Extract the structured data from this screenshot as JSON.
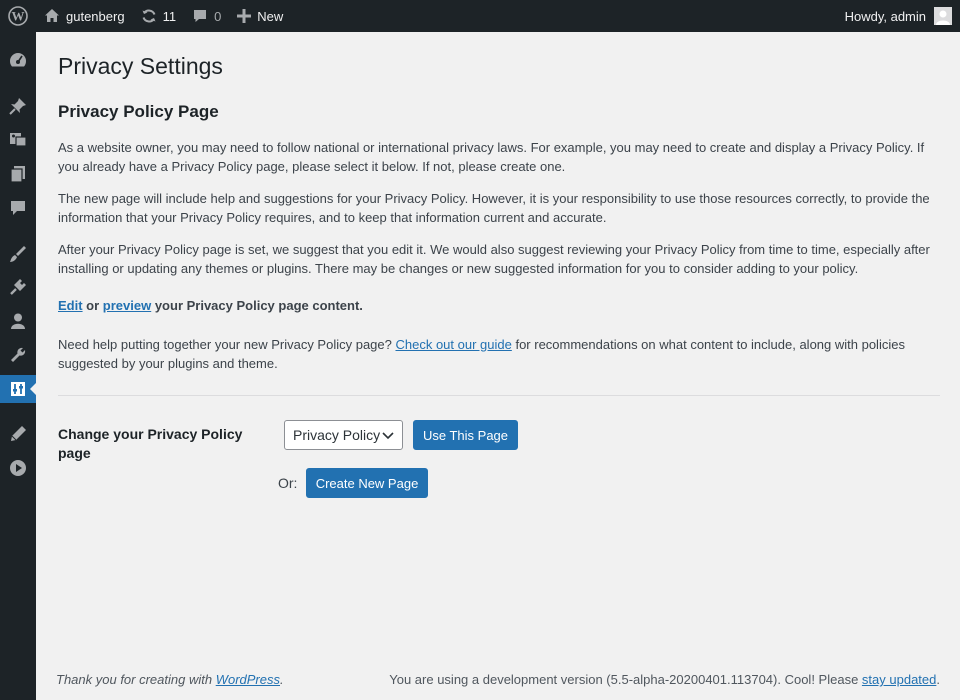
{
  "admin_bar": {
    "site_name": "gutenberg",
    "updates_count": "11",
    "comments_count": "0",
    "new_label": "New",
    "greeting": "Howdy, admin"
  },
  "sidebar": {
    "items": [
      {
        "icon": "dashboard-icon"
      },
      {
        "icon": "posts-icon"
      },
      {
        "icon": "media-icon"
      },
      {
        "icon": "pages-icon"
      },
      {
        "icon": "comments-icon"
      },
      {
        "icon": "appearance-icon"
      },
      {
        "icon": "plugins-icon"
      },
      {
        "icon": "users-icon"
      },
      {
        "icon": "tools-icon"
      },
      {
        "icon": "settings-icon",
        "active": true
      },
      {
        "icon": "gutenberg-icon"
      },
      {
        "icon": "collapse-icon"
      }
    ]
  },
  "page": {
    "title": "Privacy Settings",
    "section_title": "Privacy Policy Page",
    "para1": "As a website owner, you may need to follow national or international privacy laws. For example, you may need to create and display a Privacy Policy. If you already have a Privacy Policy page, please select it below. If not, please create one.",
    "para2": "The new page will include help and suggestions for your Privacy Policy. However, it is your responsibility to use those resources correctly, to provide the information that your Privacy Policy requires, and to keep that information current and accurate.",
    "para3": "After your Privacy Policy page is set, we suggest that you edit it. We would also suggest reviewing your Privacy Policy from time to time, especially after installing or updating any themes or plugins. There may be changes or new suggested information for you to consider adding to your policy.",
    "edit_link": "Edit",
    "or_text": " or ",
    "preview_link": "preview",
    "edit_suffix": " your Privacy Policy page content.",
    "help_prefix": "Need help putting together your new Privacy Policy page? ",
    "help_link": "Check out our guide",
    "help_suffix": " for recommendations on what content to include, along with policies suggested by your plugins and theme."
  },
  "form": {
    "label": "Change your Privacy Policy page",
    "select_value": "Privacy Policy",
    "use_button": "Use This Page",
    "or_label": "Or:",
    "create_button": "Create New Page"
  },
  "footer": {
    "thanks_prefix": "Thank you for creating with ",
    "thanks_link": "WordPress",
    "thanks_suffix": ".",
    "version_text": "You are using a development version (5.5-alpha-20200401.113704). Cool! Please ",
    "version_link": "stay updated",
    "version_suffix": "."
  },
  "colors": {
    "admin_bar": "#1d2327",
    "accent": "#2271b1",
    "background": "#f1f1f1"
  }
}
